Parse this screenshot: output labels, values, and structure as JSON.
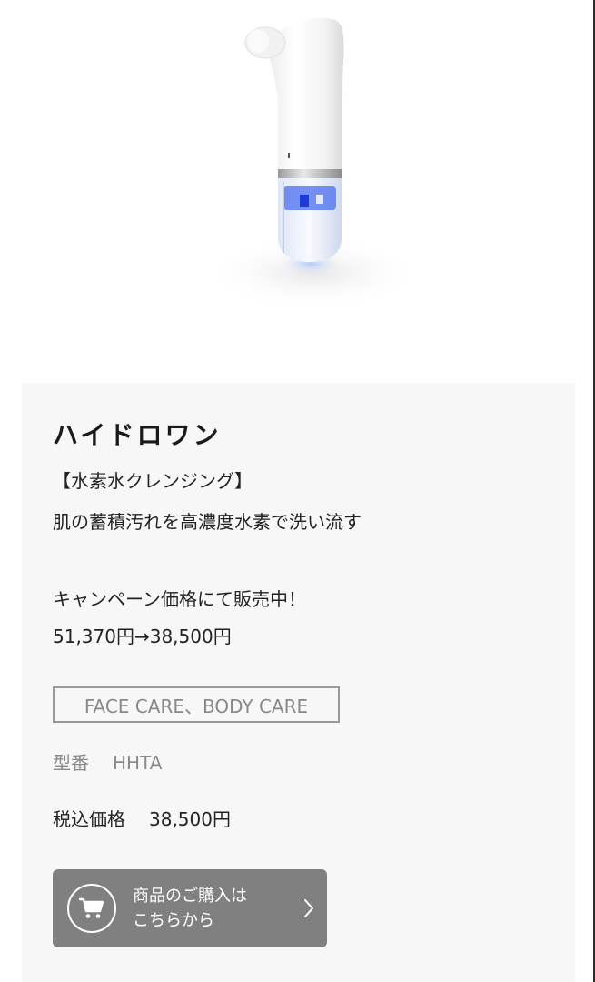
{
  "product": {
    "name": "ハイドロワン",
    "subtitle": "【水素水クレンジング】",
    "tagline": "肌の蓄積汚れを高濃度水素で洗い流す",
    "campaign": "キャンペーン価格にて販売中！",
    "price_change": "51,370円→38,500円",
    "category_tag": "FACE CARE、BODY CARE",
    "model_label": "型番",
    "model_value": "HHTA",
    "price_label": "税込価格",
    "price_value": "38,500円"
  },
  "purchase_button": {
    "label": "商品のご購入は\nこちらから",
    "cart_icon": "cart-icon",
    "arrow_icon": "chevron-right-icon"
  },
  "colors": {
    "card_background": "#f7f7f7",
    "button_background": "#808080",
    "tag_border": "#999999",
    "device_light": "#3a6cff"
  }
}
